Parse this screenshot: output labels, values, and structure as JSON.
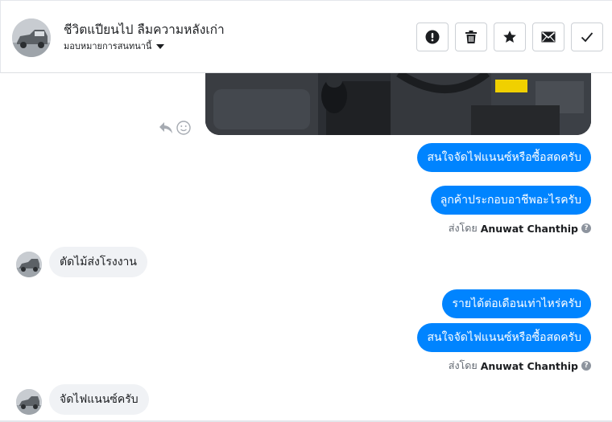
{
  "header": {
    "title": "ชีวิตแปียนไป ลืมความหลังเก่า",
    "assign_label": "มอบหมายการสนทนานี้"
  },
  "actions": [
    {
      "name": "report-spam",
      "icon": "exclamation-circle-icon"
    },
    {
      "name": "delete",
      "icon": "trash-icon"
    },
    {
      "name": "star",
      "icon": "star-icon"
    },
    {
      "name": "mark-unread",
      "icon": "envelope-icon"
    },
    {
      "name": "mark-done",
      "icon": "checkmark-icon"
    }
  ],
  "messages": {
    "out_1": "สนใจจัดไฟแนนซ์หรือซื้อสดครับ",
    "out_2": "ลูกค้าประกอบอาชีพอะไรครับ",
    "sent_by_1": {
      "prefix": "ส่งโดย",
      "name": "Anuwat Chanthip"
    },
    "in_1": "ตัดไม้ส่งโรงงาน",
    "out_3": "รายได้ต่อเดือนเท่าไหร่ครับ",
    "out_4": "สนใจจัดไฟแนนซ์หรือซื้อสดครับ",
    "sent_by_2": {
      "prefix": "ส่งโดย",
      "name": "Anuwat Chanthip"
    },
    "in_2": "จัดไฟแนนซ์ครับ"
  },
  "colors": {
    "outgoing_bubble": "#0084ff",
    "incoming_bubble": "#f0f2f5",
    "border": "#ccd0d5"
  }
}
